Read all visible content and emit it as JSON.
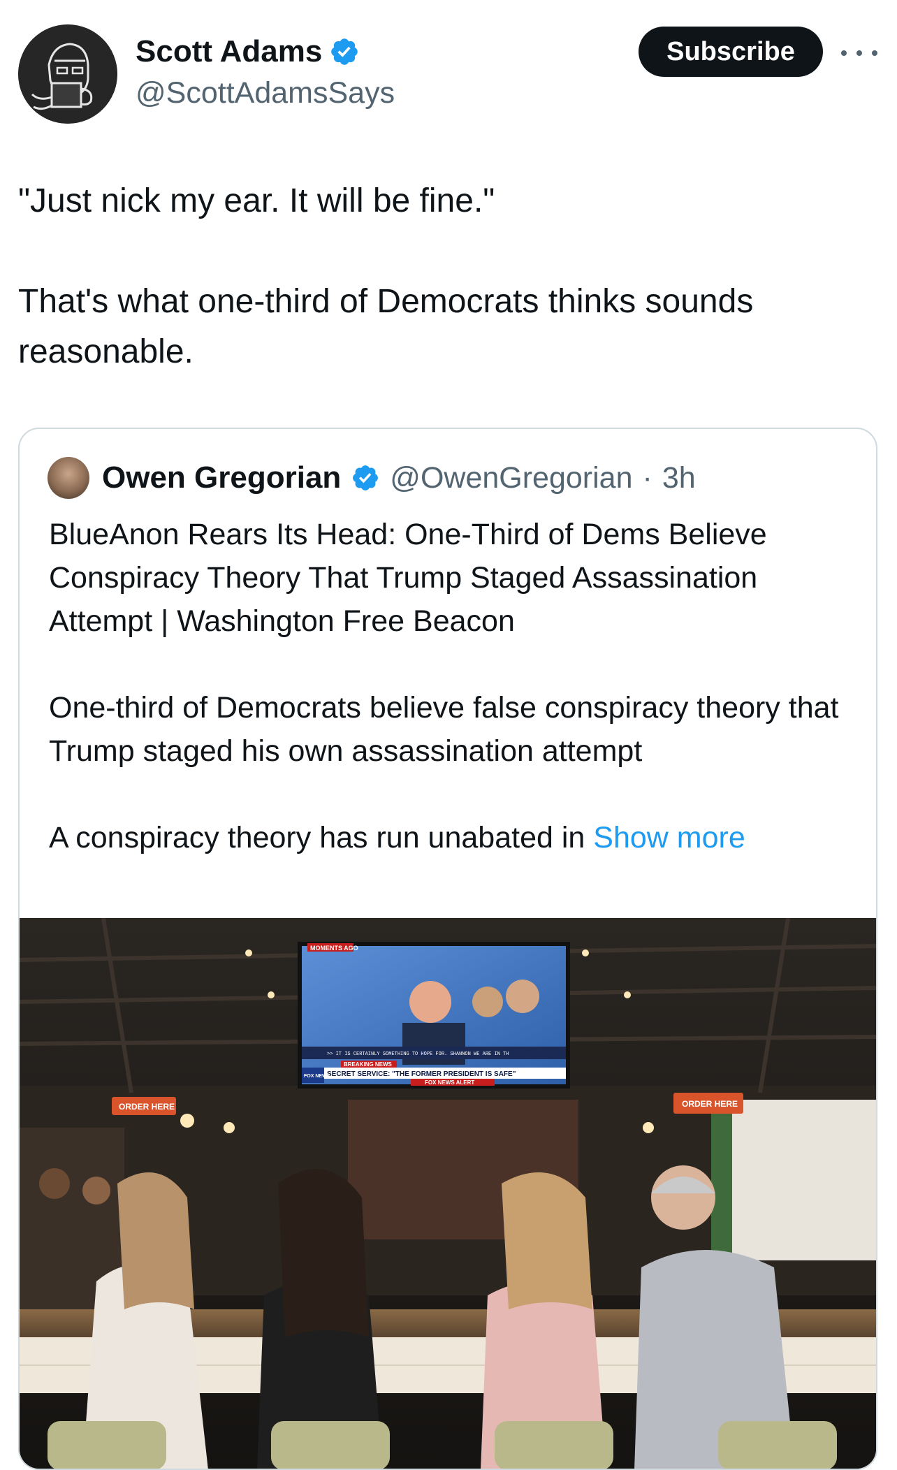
{
  "author": {
    "name": "Scott Adams",
    "handle": "@ScottAdamsSays",
    "verified": true,
    "avatar_icon": "avatar-drinking-mug-illustration"
  },
  "actions": {
    "subscribe_label": "Subscribe",
    "more_icon": "more-horizontal-icon"
  },
  "tweet": {
    "line1": "\"Just nick my ear. It will be fine.\"",
    "line2": "That's what one-third of Democrats thinks sounds reasonable."
  },
  "quoted": {
    "name": "Owen Gregorian",
    "handle": "@OwenGregorian",
    "separator": "·",
    "time": "3h",
    "headline": "BlueAnon Rears Its Head: One-Third of Dems Believe Conspiracy Theory That Trump Staged Assassination Attempt | Washington Free Beacon",
    "summary": "One-third of Democrats believe false conspiracy theory that Trump staged his own assassination attempt",
    "excerpt": "A conspiracy theory has run unabated in",
    "show_more_label": "Show more"
  },
  "photo": {
    "tv_tag": "MOMENTS AGO",
    "tv_breaking": "BREAKING NEWS",
    "tv_network": "FOX NEWS",
    "tv_headline": "SECRET SERVICE: \"THE FORMER PRESIDENT IS SAFE\"",
    "tv_alert": "FOX NEWS ALERT",
    "tv_ticker": ">> IT IS CERTAINLY SOMETHING TO HOPE FOR. SHANNON WE ARE IN TH",
    "sign_left": "ORDER HERE",
    "sign_right": "ORDER HERE"
  },
  "colors": {
    "text": "#0f1419",
    "secondary": "#536471",
    "link": "#1d9bf0",
    "verified": "#1d9bf0",
    "border": "#cfd9de",
    "sign_orange": "#d9542b"
  }
}
